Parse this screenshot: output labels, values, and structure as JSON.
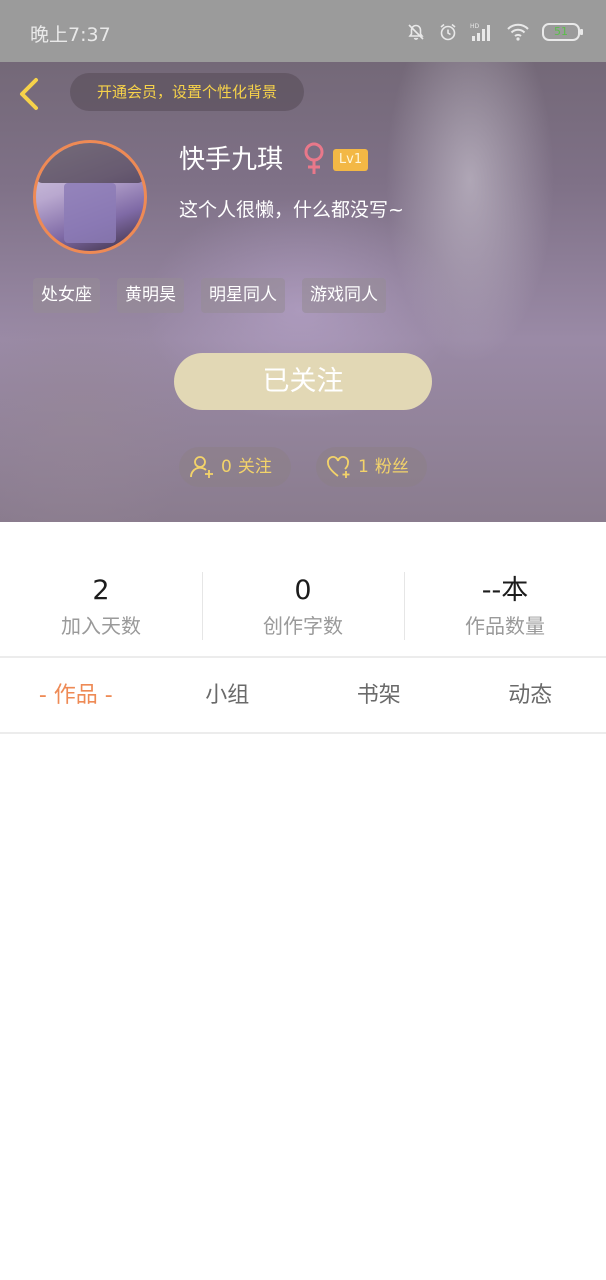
{
  "status_bar": {
    "time": "晚上7:37",
    "battery": "51",
    "icons": [
      "mute-bell-icon",
      "alarm-icon",
      "hd-signal-icon",
      "wifi-icon",
      "battery-icon"
    ]
  },
  "header": {
    "vip_banner": "开通会员，设置个性化背景",
    "nickname": "快手九琪",
    "gender": "female",
    "level": "Lv1",
    "bio": "这个人很懒，什么都没写~",
    "tags": [
      "处女座",
      "黄明昊",
      "明星同人",
      "游戏同人"
    ],
    "follow_button": "已关注",
    "following_count": "0",
    "following_label": "关注",
    "fans_count": "1",
    "fans_label": "粉丝"
  },
  "stats": [
    {
      "value": "2",
      "label": "加入天数"
    },
    {
      "value": "0",
      "label": "创作字数"
    },
    {
      "value": "--本",
      "label": "作品数量"
    }
  ],
  "tabs": [
    {
      "label": "- 作品 -",
      "active": true
    },
    {
      "label": "小组",
      "active": false
    },
    {
      "label": "书架",
      "active": false
    },
    {
      "label": "动态",
      "active": false
    }
  ],
  "colors": {
    "accent": "#ee8a55",
    "vip_text": "#f6d24a",
    "level_badge": "#f3b845",
    "follow_button": "#e2d8b5",
    "status_bar": "#9b9b9b"
  }
}
